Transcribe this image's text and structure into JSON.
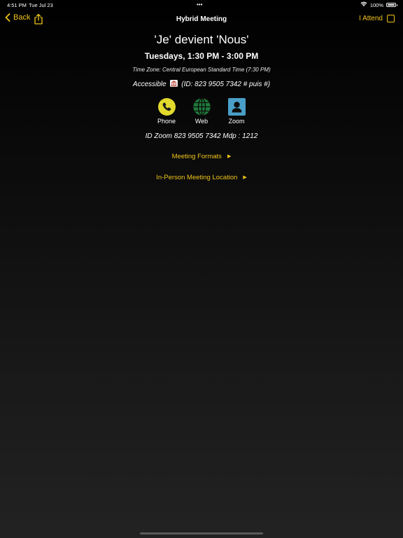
{
  "status_bar": {
    "time": "4:51 PM",
    "date": "Tue Jul 23",
    "dots": "•••",
    "battery": "100%",
    "battery_level": 1.0
  },
  "nav": {
    "back_label": "Back",
    "title": "Hybrid Meeting",
    "attend_label": "I Attend"
  },
  "meeting": {
    "name": "'Je' devient 'Nous'",
    "time": "Tuesdays, 1:30 PM - 3:00 PM",
    "time_zone": "Time Zone: Central European Standard Time (7:30 PM)",
    "accessible_label": "Accessible",
    "accessible_detail": "(ID: 823 9505 7342 # puis #)"
  },
  "links": {
    "phone": "Phone",
    "web": "Web",
    "zoom": "Zoom"
  },
  "zoom_info": "ID Zoom 823 9505 7342 Mdp : 1212",
  "meeting_formats": "Meeting Formats",
  "location": "In-Person Meeting Location",
  "colors": {
    "accent": "#f0c419",
    "phone_bg": "#e2da2c",
    "web_globe": "#1f7a3a",
    "zoom_bg": "#4a9fc8"
  }
}
